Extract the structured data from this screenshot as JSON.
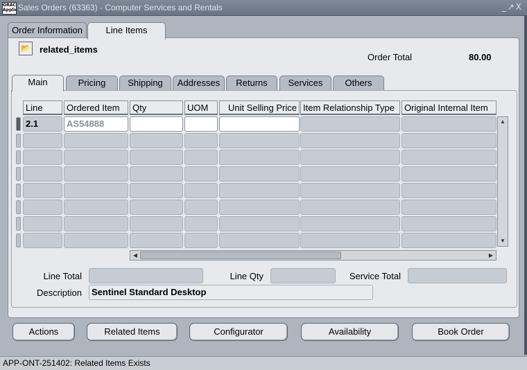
{
  "window": {
    "title": "Sales Orders (63363) - Computer Services and Rentals",
    "logo_text": "ORACLE Applications",
    "controls": "_↗X"
  },
  "top_tabs": [
    "Order Information",
    "Line Items"
  ],
  "region": {
    "title": "related_items",
    "order_total_label": "Order Total",
    "order_total_value": "80.00"
  },
  "inner_tabs": [
    "Main",
    "Pricing",
    "Shipping",
    "Addresses",
    "Returns",
    "Services",
    "Others"
  ],
  "table": {
    "columns": [
      "Line",
      "Ordered Item",
      "Qty",
      "UOM",
      "Unit Selling Price",
      "Item Relationship Type",
      "Original Internal Item"
    ],
    "rows": [
      [
        "2.1",
        "AS54888",
        "",
        "",
        "",
        "",
        ""
      ],
      [
        "",
        "",
        "",
        "",
        "",
        "",
        ""
      ],
      [
        "",
        "",
        "",
        "",
        "",
        "",
        ""
      ],
      [
        "",
        "",
        "",
        "",
        "",
        "",
        ""
      ],
      [
        "",
        "",
        "",
        "",
        "",
        "",
        ""
      ],
      [
        "",
        "",
        "",
        "",
        "",
        "",
        ""
      ],
      [
        "",
        "",
        "",
        "",
        "",
        "",
        ""
      ],
      [
        "",
        "",
        "",
        "",
        "",
        "",
        ""
      ]
    ]
  },
  "summary": {
    "line_total_label": "Line Total",
    "line_total": "",
    "line_qty_label": "Line Qty",
    "line_qty": "",
    "service_total_label": "Service Total",
    "service_total": "",
    "description_label": "Description",
    "description": "Sentinel Standard Desktop"
  },
  "buttons": [
    "Actions",
    "Related Items",
    "Configurator",
    "Availability",
    "Book Order"
  ],
  "status_text": "APP-ONT-251402: Related Items Exists"
}
